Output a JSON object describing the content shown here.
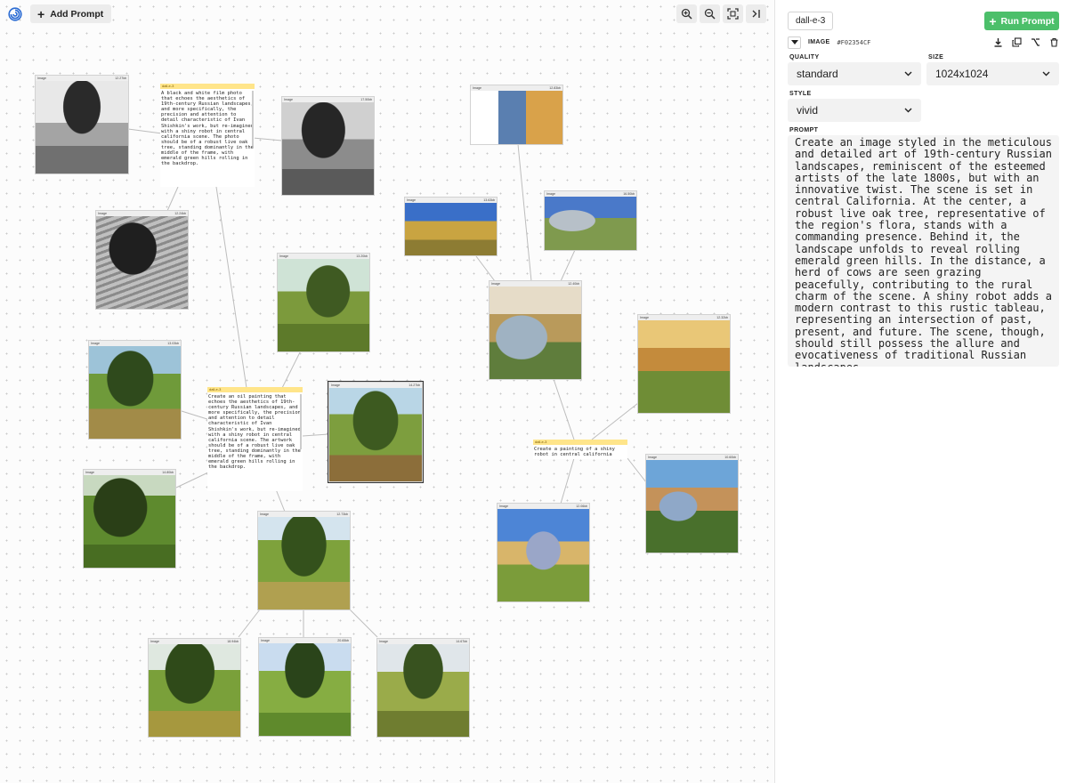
{
  "toolbar": {
    "add_prompt_label": "Add Prompt"
  },
  "colors": {
    "accent_green": "#4cbf6a",
    "prompt_highlight": "#ffe58a"
  },
  "canvas": {
    "image_nodes": [
      {
        "label": "Image",
        "size": "12.27kb"
      },
      {
        "label": "Image",
        "size": "17.50kb"
      },
      {
        "label": "Image",
        "size": "12.24kb"
      },
      {
        "label": "Image",
        "size": "13.20kb"
      },
      {
        "label": "Image",
        "size": "13.03kb"
      },
      {
        "label": "Image",
        "size": "14.80kb"
      },
      {
        "label": "Image",
        "size": "14.27kb"
      },
      {
        "label": "Image",
        "size": "12.73kb"
      },
      {
        "label": "Image",
        "size": "18.94kb"
      },
      {
        "label": "Image",
        "size": "20.65kb"
      },
      {
        "label": "Image",
        "size": "14.67kb"
      },
      {
        "label": "Image",
        "size": "12.83kb"
      },
      {
        "label": "Image",
        "size": "13.63kb"
      },
      {
        "label": "Image",
        "size": "16.50kb"
      },
      {
        "label": "Image",
        "size": "12.40kb"
      },
      {
        "label": "Image",
        "size": "12.32kb"
      },
      {
        "label": "Image",
        "size": "10.60kb"
      },
      {
        "label": "Image",
        "size": "12.06kb"
      }
    ],
    "prompt_nodes": [
      {
        "model": "dall-e-3",
        "text": "A black and white film photo that echoes the aesthetics of 19th-century Russian landscapes, and more specifically, the precision and attention to detail characteristic of Ivan Shishkin's work, but re-imagined with a shiny robot in central california scene. The photo should be of a robust live oak tree, standing dominantly in the middle of the frame, with emerald green hills rolling in the backdrop."
      },
      {
        "model": "dall-e-3",
        "text": "Create an oil painting that echoes the aesthetics of 19th-century Russian landscapes, and more specifically, the precision and attention to detail characteristic of Ivan Shishkin's work, but re-imagined with a shiny robot in central california scene. The artwork should be of a robust live oak tree, standing dominantly in the middle of the frame, with emerald green hills rolling in the backdrop."
      },
      {
        "model": "dall-e-3",
        "text": "Create a painting of a shiny robot in central california"
      }
    ]
  },
  "panel": {
    "model": "dall-e-3",
    "run_label": "Run Prompt",
    "type_label": "IMAGE",
    "node_id": "#F02354CF",
    "quality_label": "QUALITY",
    "quality_value": "standard",
    "size_label": "SIZE",
    "size_value": "1024x1024",
    "style_label": "STYLE",
    "style_value": "vivid",
    "prompt_label": "PROMPT",
    "prompt_text": "Create an image styled in the meticulous and detailed art of 19th-century Russian landscapes, reminiscent of the esteemed artists of the late 1800s, but with an innovative twist. The scene is set in central California. At the center, a robust live oak tree, representative of the region's flora, stands with a commanding presence. Behind it, the landscape unfolds to reveal rolling emerald green hills. In the distance, a herd of cows are seen grazing peacefully, contributing to the rural charm of the scene. A shiny robot adds a modern contrast to this rustic tableau, representing an intersection of past, present, and future. The scene, though, should still possess the allure and evocativeness of traditional Russian landscapes."
  }
}
